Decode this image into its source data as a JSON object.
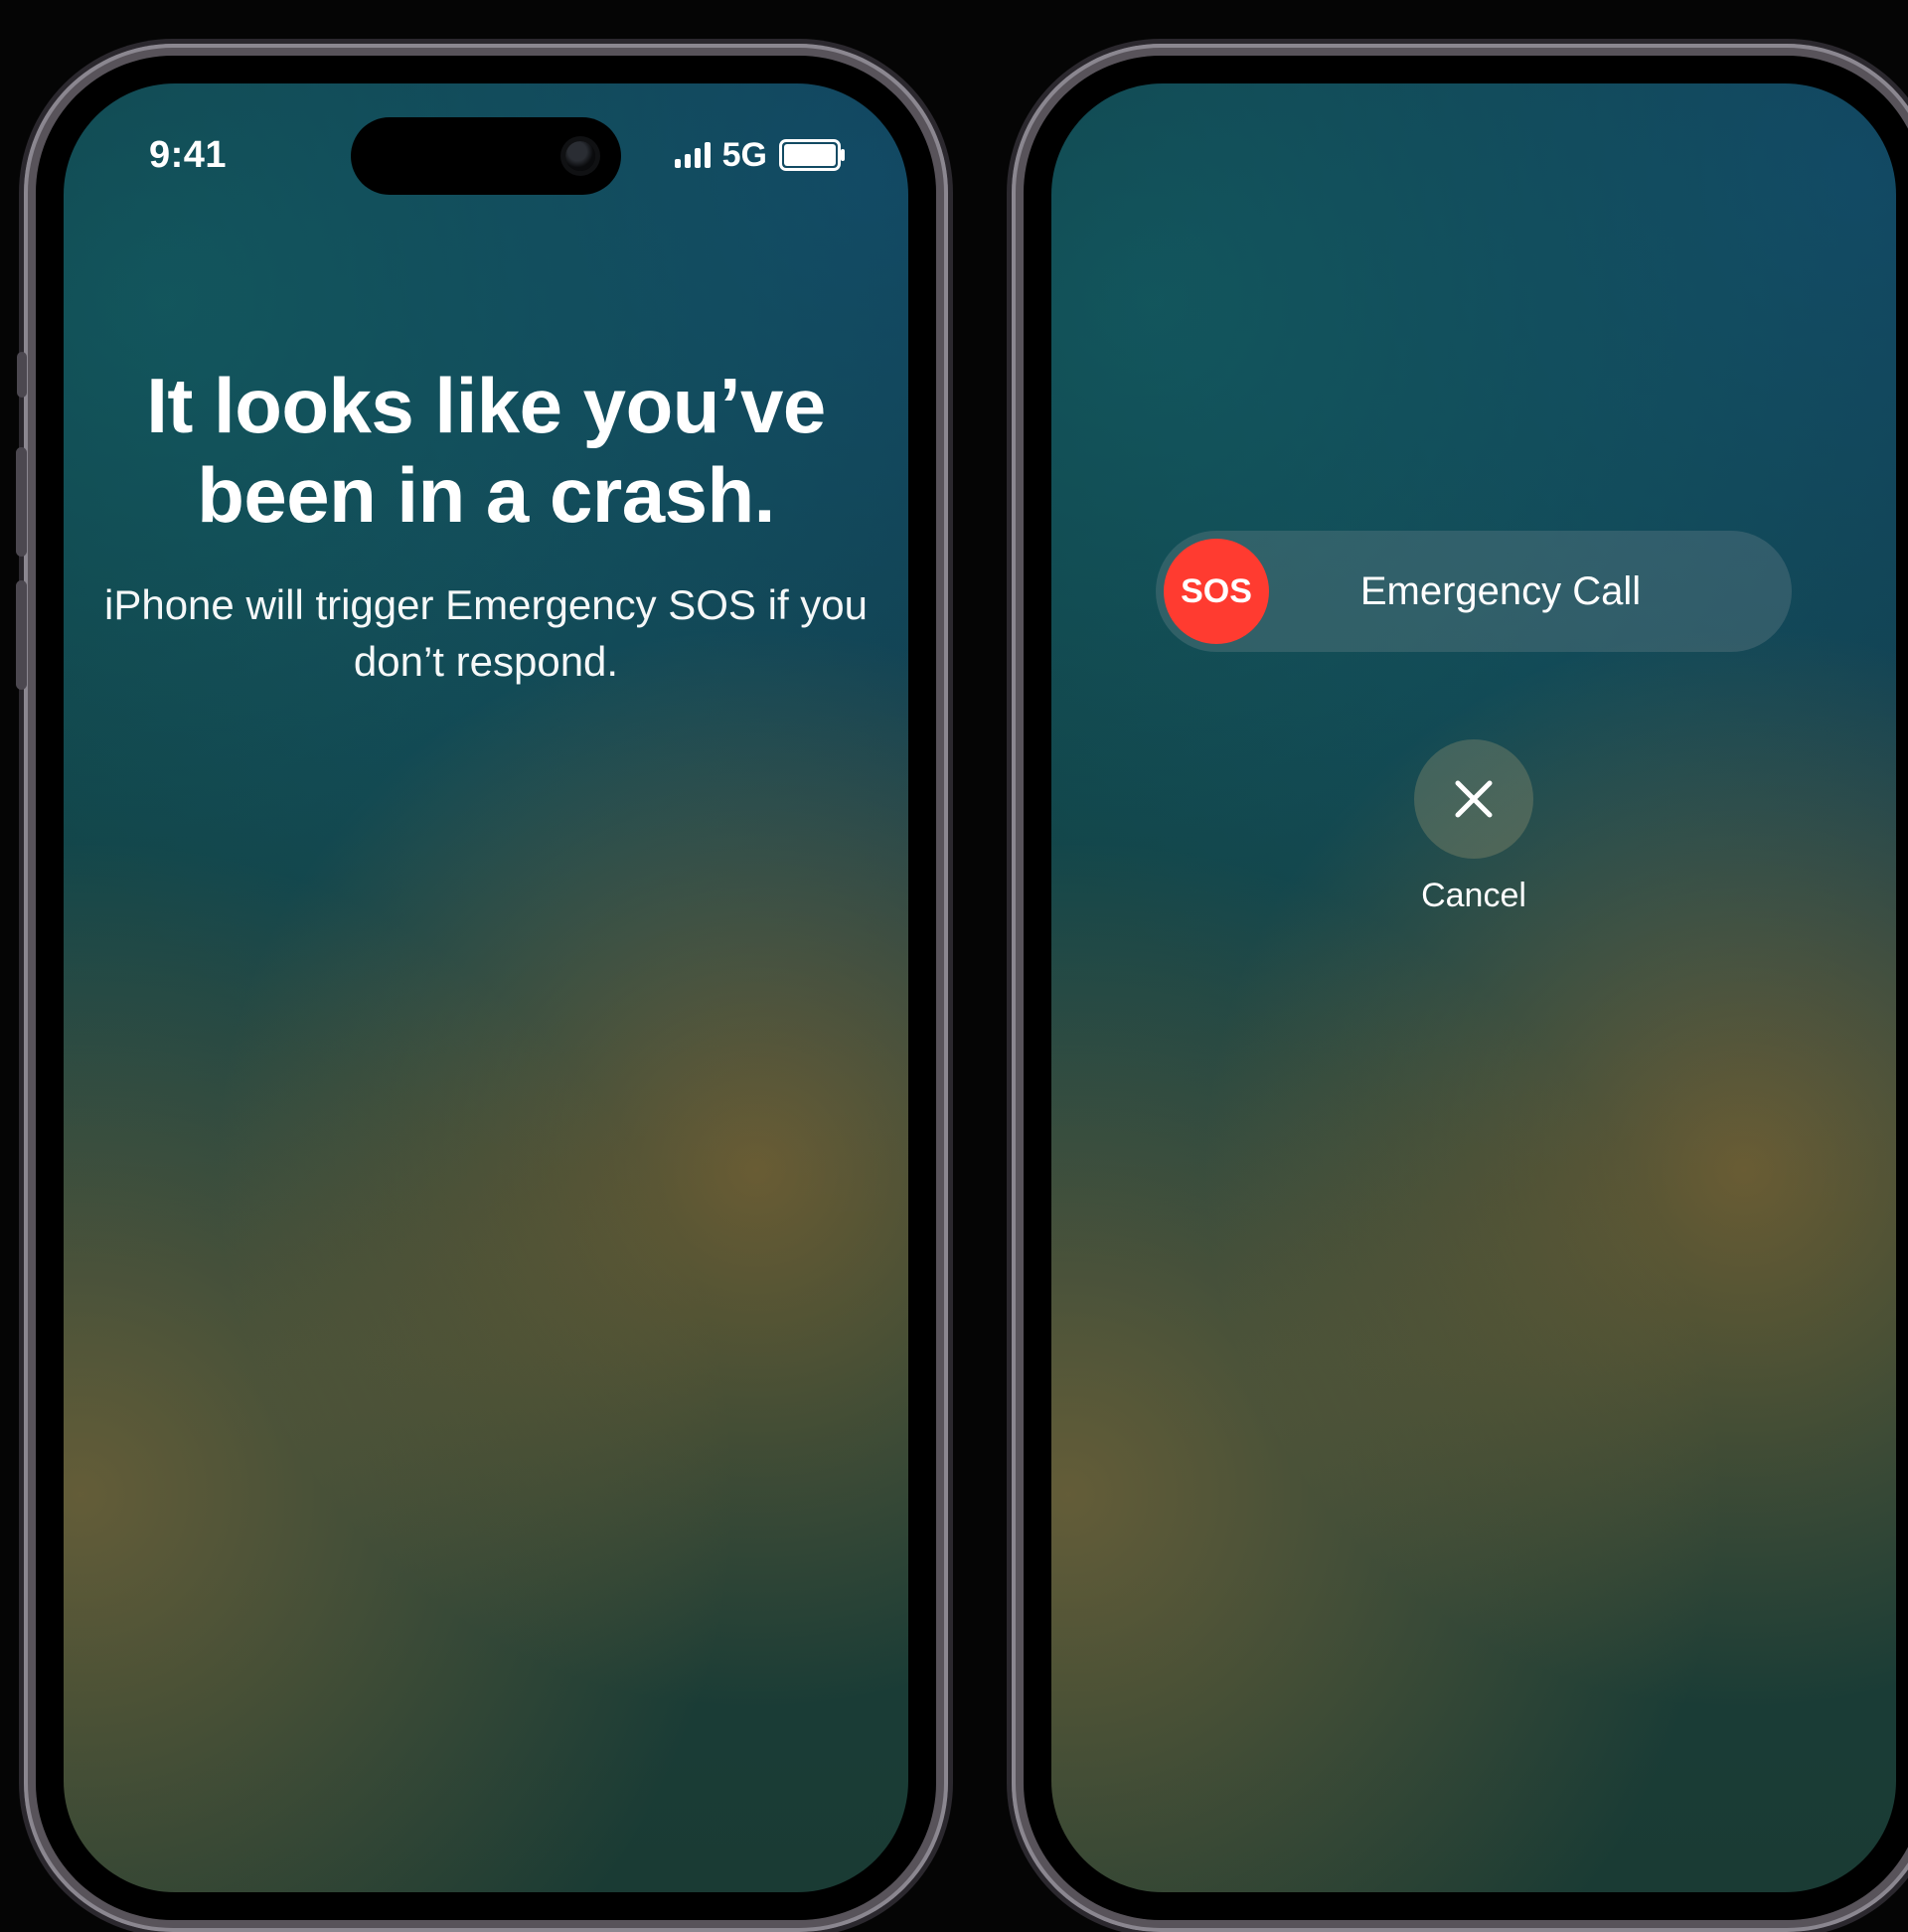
{
  "status": {
    "time": "9:41",
    "network": "5G"
  },
  "crash": {
    "headline": "It looks like you’ve been in a crash.",
    "subline": "iPhone will trigger Emergency SOS if you don’t respond."
  },
  "sos": {
    "knob": "SOS",
    "label": "Emergency Call"
  },
  "cancel": {
    "label": "Cancel"
  },
  "colors": {
    "sos_red": "#ff3b30"
  }
}
